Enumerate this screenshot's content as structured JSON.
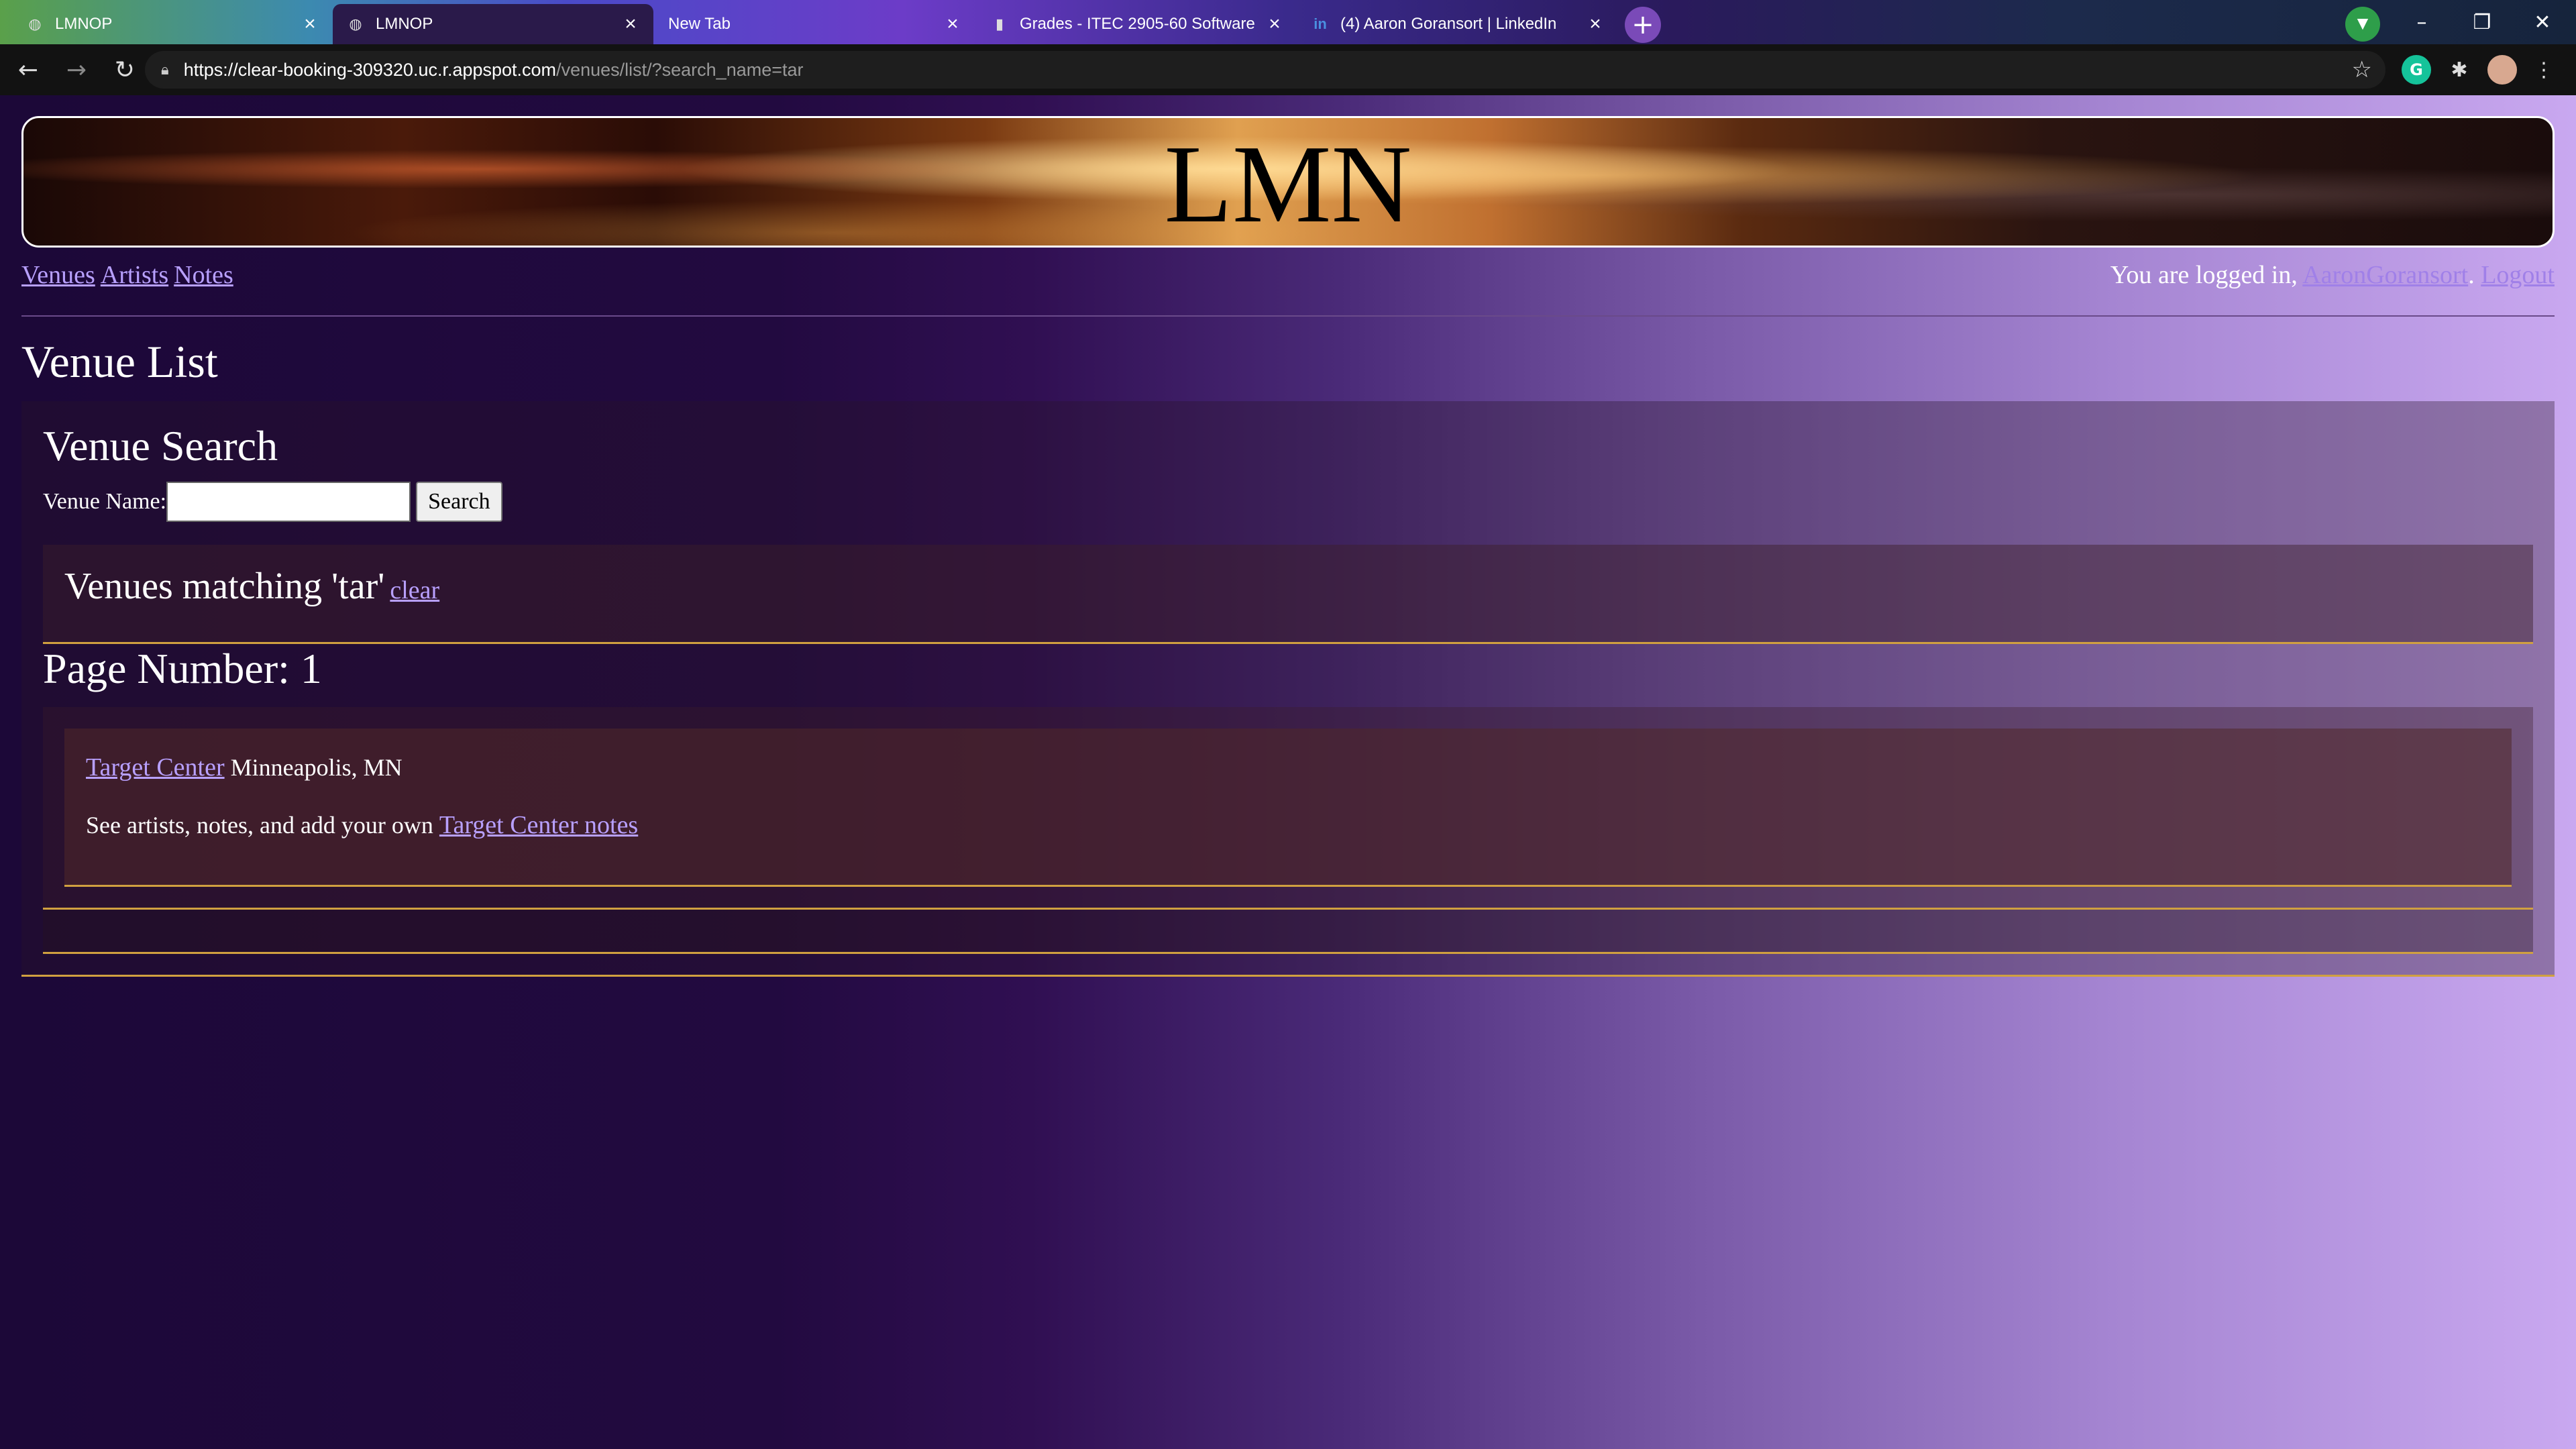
{
  "browser": {
    "tabs": [
      {
        "title": "LMNOP",
        "icon": "globe-icon",
        "active": false
      },
      {
        "title": "LMNOP",
        "icon": "globe-icon",
        "active": true
      },
      {
        "title": "New Tab",
        "icon": "",
        "active": false
      },
      {
        "title": "Grades - ITEC 2905-60 Software",
        "icon": "d2l-icon",
        "active": false
      },
      {
        "title": "(4) Aaron Goransort | LinkedIn",
        "icon": "linkedin-icon",
        "active": false
      }
    ],
    "url_host": "https://clear-booking-309320.uc.r.appspot.com",
    "url_path": "/venues/list/?search_name=tar"
  },
  "site": {
    "banner_title": "LMN",
    "nav": {
      "venues": "Venues",
      "artists": "Artists",
      "notes": "Notes"
    },
    "login": {
      "prefix": "You are logged in, ",
      "username": "AaronGoransort",
      "separator": ". ",
      "logout": "Logout"
    }
  },
  "main": {
    "page_title": "Venue List",
    "search": {
      "title": "Venue Search",
      "label": "Venue Name:",
      "input_value": "",
      "button": "Search"
    },
    "matching": {
      "text": "Venues matching 'tar'",
      "clear": "clear"
    },
    "page_number": "Page Number: 1",
    "results": [
      {
        "name": "Target Center",
        "location": "Minneapolis, MN",
        "notes_prefix": "See artists, notes, and add your own",
        "notes_link": "Target Center notes"
      }
    ]
  }
}
